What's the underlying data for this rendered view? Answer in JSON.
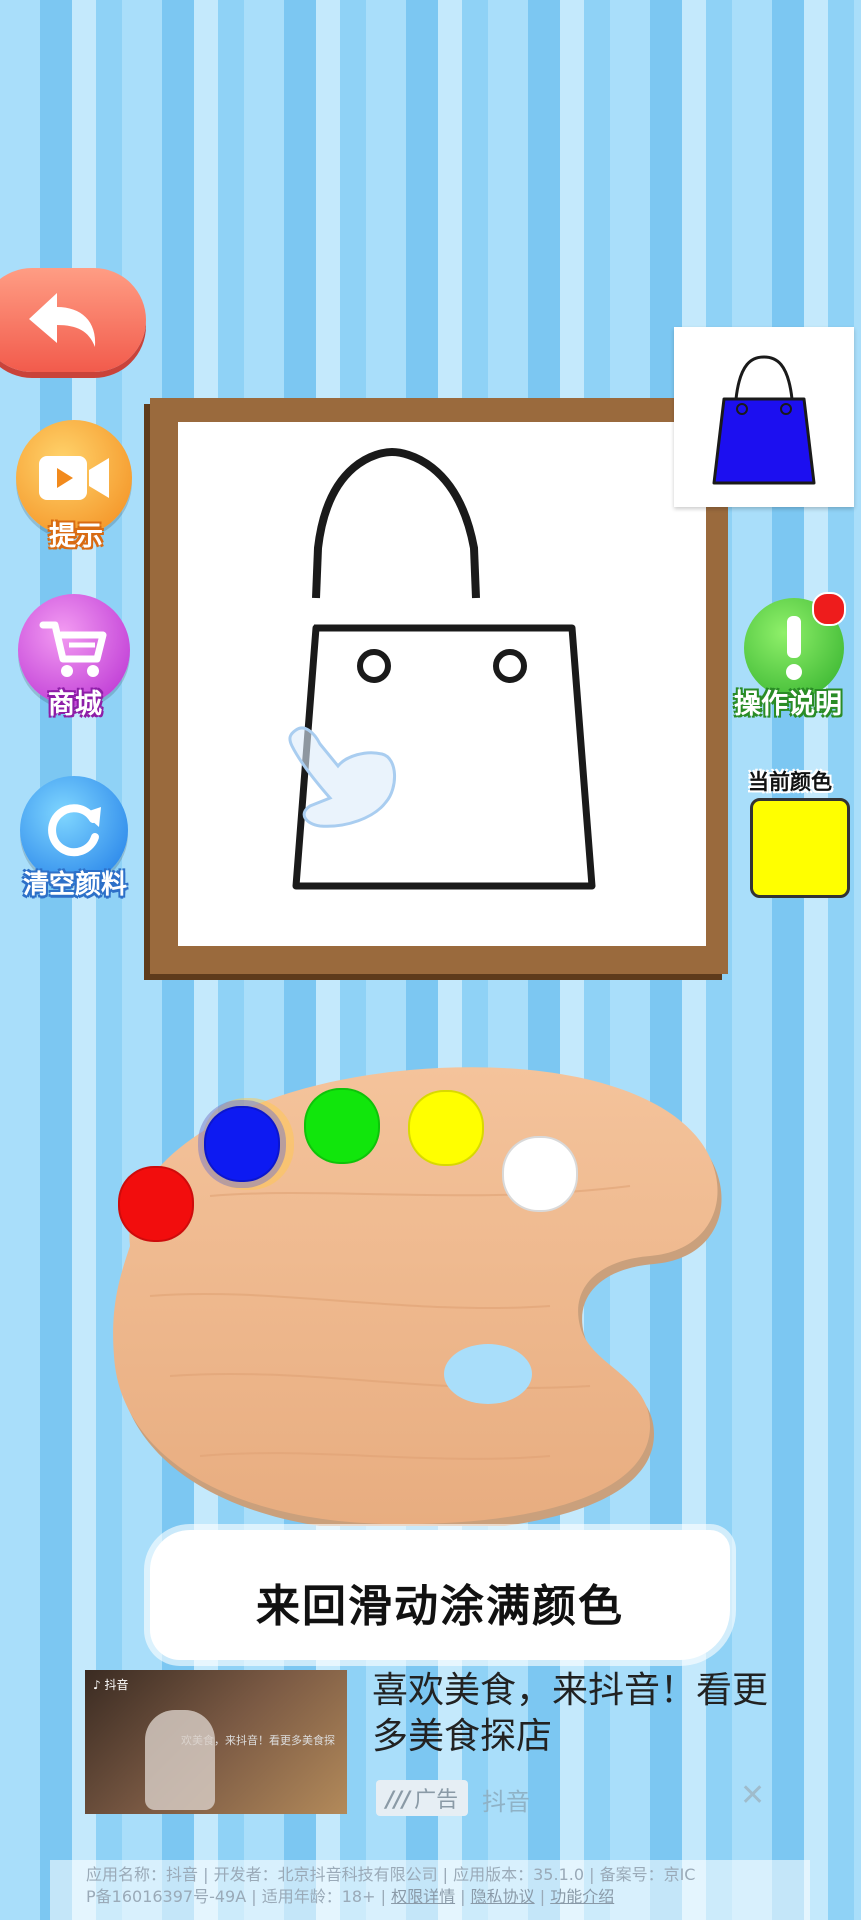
{
  "left_buttons": {
    "hint_label": "提示",
    "shop_label": "商城",
    "clear_label": "清空颜料"
  },
  "right_panel": {
    "help_label": "操作说明",
    "current_color_label": "当前颜色",
    "current_color": "#ffff00"
  },
  "reference_color": "#1c0ff0",
  "palette": {
    "colors": [
      {
        "name": "red",
        "hex": "#f20d0d"
      },
      {
        "name": "blue",
        "hex": "#0d1af2"
      },
      {
        "name": "green",
        "hex": "#11e60c"
      },
      {
        "name": "yellow",
        "hex": "#ffff00"
      },
      {
        "name": "white",
        "hex": "#ffffff"
      }
    ],
    "selected": "blue"
  },
  "hint_text": "来回滑动涂满颜色",
  "ad": {
    "title": "喜欢美食，来抖音！看更多美食探店",
    "tag": "广告",
    "brand": "抖音",
    "thumb_caption": "欢美食，来抖音！看更多美食探"
  },
  "legal": {
    "line1": "应用名称：抖音 | 开发者：北京抖音科技有限公司 | 应用版本：35.1.0 | 备案号：京IC",
    "line2_prefix": "P备16016397号-49A | 适用年龄：18+ | ",
    "link_permissions": "权限详情",
    "link_privacy": "隐私协议",
    "link_features": "功能介绍"
  }
}
